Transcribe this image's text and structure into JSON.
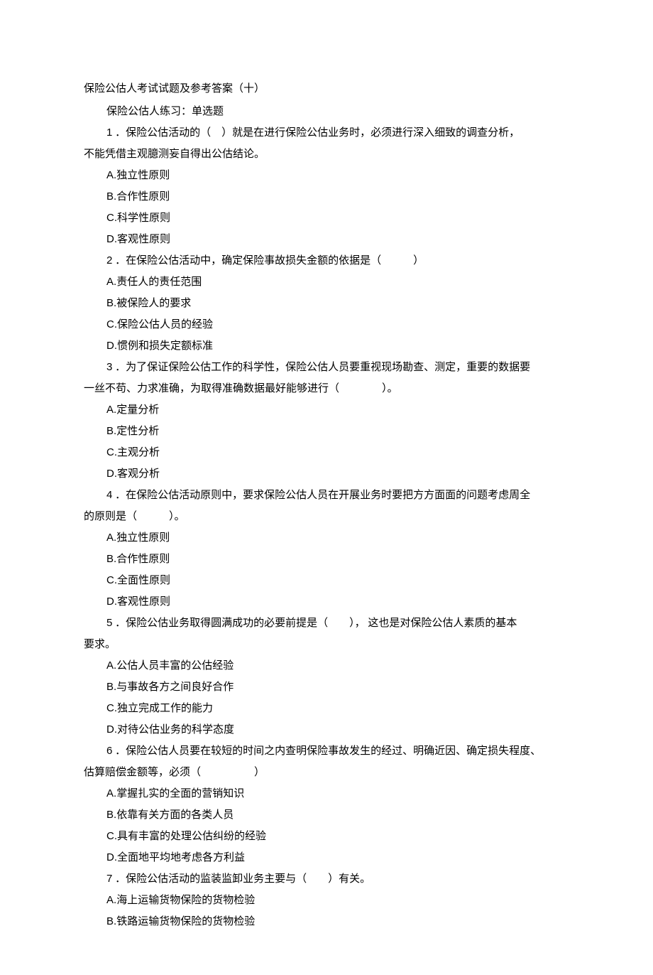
{
  "title": "保险公估人考试试题及参考答案（十）",
  "subtitle": "保险公估人练习：单选题",
  "questions": [
    {
      "num": "1",
      "stem_lines": [
        "．保险公估活动的（　）就是在进行保险公估业务时，必须进行深入细致的调查分析，",
        "不能凭借主观臆测妄自得出公估结论。"
      ],
      "options": [
        {
          "l": "A",
          "t": "独立性原则"
        },
        {
          "l": "B",
          "t": "合作性原则"
        },
        {
          "l": "C",
          "t": "科学性原则"
        },
        {
          "l": "D",
          "t": "客观性原则"
        }
      ]
    },
    {
      "num": "2",
      "stem_lines": [
        "．在保险公估活动中，确定保险事故损失金额的依据是（　　　）"
      ],
      "options": [
        {
          "l": "A",
          "t": "责任人的责任范围"
        },
        {
          "l": "B",
          "t": "被保险人的要求"
        },
        {
          "l": "C",
          "t": "保险公估人员的经验"
        },
        {
          "l": "D",
          "t": "惯例和损失定额标准"
        }
      ]
    },
    {
      "num": "3",
      "stem_lines": [
        "．为了保证保险公估工作的科学性，保险公估人员要重视现场勘查、测定，重要的数据要",
        "一丝不苟、力求准确，为取得准确数据最好能够进行（　　　　）。"
      ],
      "options": [
        {
          "l": "A",
          "t": "定量分析"
        },
        {
          "l": "B",
          "t": "定性分析"
        },
        {
          "l": "C",
          "t": "主观分析"
        },
        {
          "l": "D",
          "t": "客观分析"
        }
      ]
    },
    {
      "num": "4",
      "stem_lines": [
        "．在保险公估活动原则中，要求保险公估人员在开展业务时要把方方面面的问题考虑周全",
        "的原则是（　　　）。"
      ],
      "options": [
        {
          "l": "A",
          "t": "独立性原则"
        },
        {
          "l": "B",
          "t": "合作性原则"
        },
        {
          "l": "C",
          "t": "全面性原则"
        },
        {
          "l": "D",
          "t": "客观性原则"
        }
      ]
    },
    {
      "num": "5",
      "stem_lines": [
        "．保险公估业务取得圆满成功的必要前提是（　　）， 这也是对保险公估人素质的基本",
        "要求。"
      ],
      "options": [
        {
          "l": "A",
          "t": "公估人员丰富的公估经验"
        },
        {
          "l": "B",
          "t": "与事故各方之间良好合作"
        },
        {
          "l": "C",
          "t": "独立完成工作的能力"
        },
        {
          "l": "D",
          "t": "对待公估业务的科学态度"
        }
      ]
    },
    {
      "num": "6",
      "stem_lines": [
        "．保险公估人员要在较短的时间之内查明保险事故发生的经过、明确近因、确定损失程度、",
        "估算赔偿金额等，必须（　　　　　）"
      ],
      "options": [
        {
          "l": "A",
          "t": "掌握扎实的全面的营销知识"
        },
        {
          "l": "B",
          "t": "依靠有关方面的各类人员"
        },
        {
          "l": "C",
          "t": "具有丰富的处理公估纠纷的经验"
        },
        {
          "l": "D",
          "t": "全面地平均地考虑各方利益"
        }
      ]
    },
    {
      "num": "7",
      "stem_lines": [
        "．保险公估活动的监装监卸业务主要与（　　）有关。"
      ],
      "options": [
        {
          "l": "A",
          "t": "海上运输货物保险的货物检验"
        },
        {
          "l": "B",
          "t": "铁路运输货物保险的货物检验"
        }
      ]
    }
  ]
}
